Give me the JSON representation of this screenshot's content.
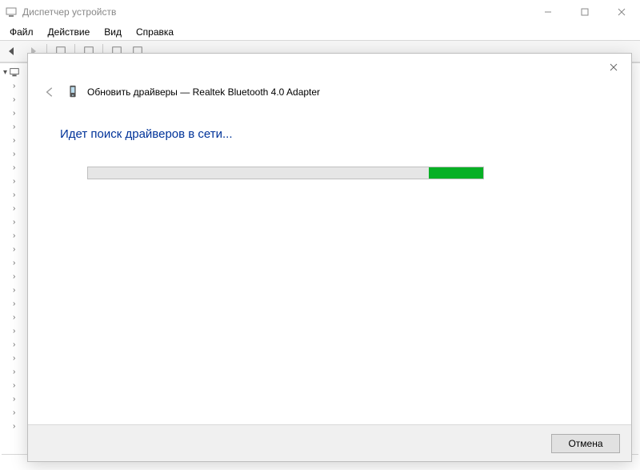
{
  "outer": {
    "title": "Диспетчер устройств",
    "menus": [
      "Файл",
      "Действие",
      "Вид",
      "Справка"
    ]
  },
  "dialog": {
    "title": "Обновить драйверы — Realtek Bluetooth 4.0 Adapter",
    "status": "Идет поиск драйверов в сети...",
    "cancel_label": "Отмена"
  }
}
